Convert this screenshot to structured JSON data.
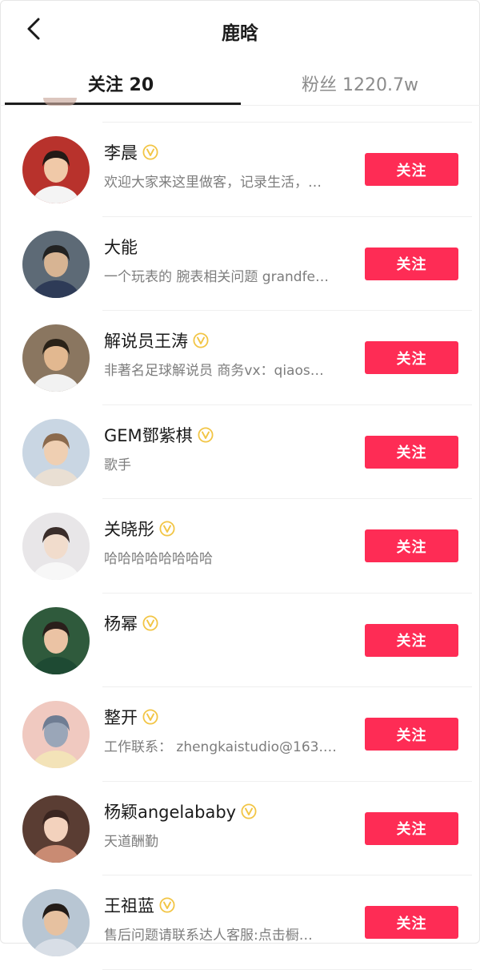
{
  "header": {
    "title": "鹿晗",
    "back_icon": "chevron-left-icon"
  },
  "tabs": {
    "following": "关注 20",
    "fans": "粉丝 1220.7w"
  },
  "accent_color": "#fe2c55",
  "follow_label": "关注",
  "users": [
    {
      "name": "李晨",
      "verified": true,
      "bio": "欢迎大家来这里做客，记录生活，…",
      "avatar": {
        "bg": "#b8322c",
        "face": "#f0c9a8",
        "hair": "#231a16",
        "body": "#f4f4f4"
      }
    },
    {
      "name": "大能",
      "verified": false,
      "bio": "一个玩表的 腕表相关问题 grandfe…",
      "avatar": {
        "bg": "#5d6a76",
        "face": "#d7b493",
        "hair": "#222222",
        "body": "#2e3b57"
      }
    },
    {
      "name": "解说员王涛",
      "verified": true,
      "bio": "非著名足球解说员 商务vx：qiaos…",
      "avatar": {
        "bg": "#8a7660",
        "face": "#e2b890",
        "hair": "#2a2218",
        "body": "#f2f2f2"
      }
    },
    {
      "name": "GEM鄧紫棋",
      "verified": true,
      "bio": "歌手",
      "avatar": {
        "bg": "#c9d6e3",
        "face": "#efcfb2",
        "hair": "#8b6a4d",
        "body": "#e9dfd3"
      }
    },
    {
      "name": "关晓彤",
      "verified": true,
      "bio": "哈哈哈哈哈哈哈哈",
      "avatar": {
        "bg": "#e8e6e8",
        "face": "#f1dccc",
        "hair": "#3a2d2a",
        "body": "#f7f7f7"
      }
    },
    {
      "name": "杨幂",
      "verified": true,
      "bio": "",
      "avatar": {
        "bg": "#2f5a3c",
        "face": "#ebc3a4",
        "hair": "#2a1f1b",
        "body": "#1e4a33"
      }
    },
    {
      "name": "整开",
      "verified": true,
      "bio": "工作联系： zhengkaistudio@163.…",
      "avatar": {
        "bg": "#f0c9c0",
        "face": "#9aa6b8",
        "hair": "#6f7d93",
        "body": "#f3e3b8"
      }
    },
    {
      "name": "杨颖angelababy",
      "verified": true,
      "bio": "天道酬勤",
      "avatar": {
        "bg": "#5a3d33",
        "face": "#f3d2bd",
        "hair": "#3a2520",
        "body": "#c98b73"
      }
    },
    {
      "name": "王祖蓝",
      "verified": true,
      "bio": "售后问题请联系达人客服:点击橱…",
      "avatar": {
        "bg": "#b8c6d3",
        "face": "#e6c1a0",
        "hair": "#231c18",
        "body": "#d8dee6"
      }
    }
  ]
}
